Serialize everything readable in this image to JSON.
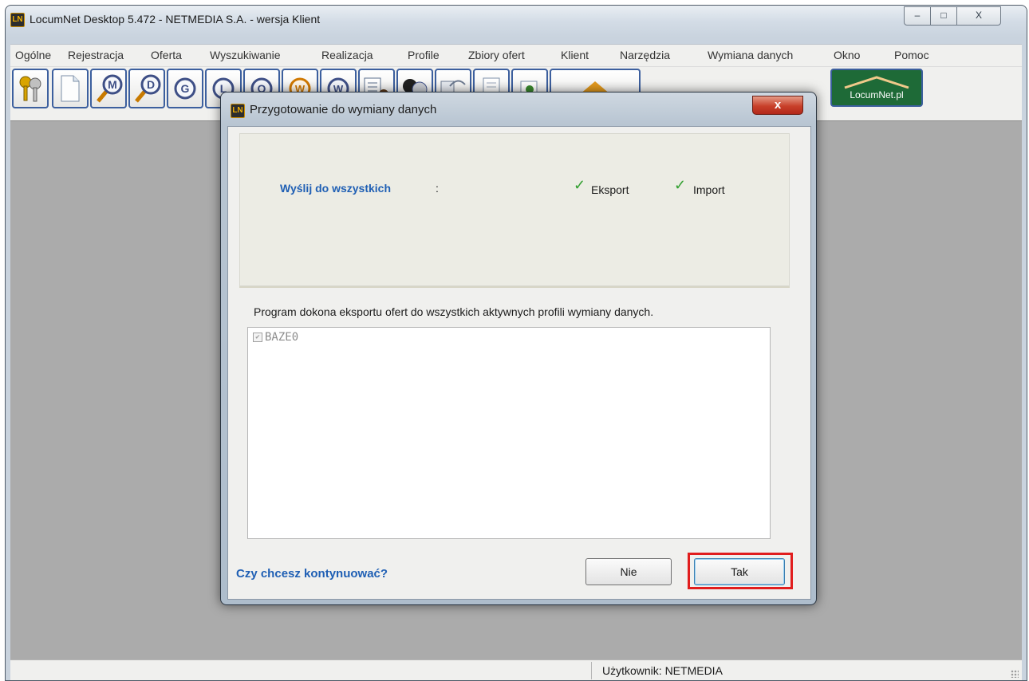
{
  "window": {
    "title": "LocumNet Desktop 5.472 - NETMEDIA S.A. - wersja Klient",
    "icon_text": "LN",
    "controls": {
      "minimize": "–",
      "maximize": "□",
      "close": "X"
    }
  },
  "menu": [
    "Ogólne",
    "Rejestracja",
    "Oferta",
    "Wyszukiwanie",
    "Realizacja",
    "Profile",
    "Zbiory ofert",
    "Klient",
    "Narzędzia",
    "Wymiana danych",
    "Okno",
    "Pomoc"
  ],
  "toolbar": {
    "buttons": [
      "keys-icon",
      "new-document-icon",
      "search-m-icon",
      "search-d-icon",
      "g-icon",
      "l-icon",
      "o-icon",
      "w-icon",
      "w2-icon",
      "export-icon",
      "users-icon",
      "transfer-icon",
      "document-icon",
      "refresh-icon",
      "house-icon"
    ],
    "labels": {
      "m": "M",
      "d": "D",
      "g": "G",
      "l": "L",
      "o": "O",
      "w": "W"
    },
    "logo_text": "LocumNet.pl"
  },
  "status": {
    "user": "Użytkownik: NETMEDIA"
  },
  "dialog": {
    "title": "Przygotowanie do wymiany danych",
    "close_label": "x",
    "send_label": "Wyślij do wszystkich",
    "send_colon": ":",
    "export_label": "Eksport",
    "export_checked": true,
    "import_label": "Import",
    "import_checked": true,
    "check_glyph": "✓",
    "info_text": "Program dokona eksportu ofert do wszystkich aktywnych profili wymiany danych.",
    "profiles": [
      {
        "name": "BAZE0",
        "checked": true,
        "enabled": false
      }
    ],
    "question": "Czy chcesz kontynuować?",
    "no_label": "Nie",
    "yes_label": "Tak"
  },
  "colors": {
    "accent_text": "#1f5fb4",
    "check": "#33a031",
    "highlight": "#e11d1d",
    "mdi_background": "#ababab"
  }
}
